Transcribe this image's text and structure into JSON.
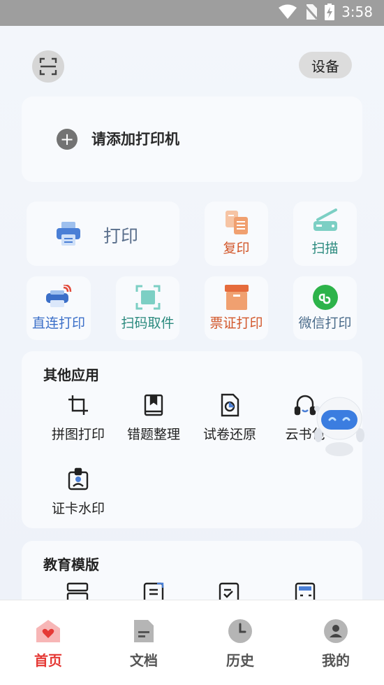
{
  "status_bar": {
    "time": "3:58"
  },
  "header": {
    "device_button": "设备"
  },
  "printer": {
    "add_label": "请添加打印机"
  },
  "main_actions": {
    "print": "打印",
    "copy": "复印",
    "scan": "扫描"
  },
  "quick_actions": [
    {
      "label": "直连打印",
      "color": "#3b6fc8"
    },
    {
      "label": "扫码取件",
      "color": "#2b8a7e"
    },
    {
      "label": "票证打印",
      "color": "#d2572a"
    },
    {
      "label": "微信打印",
      "color": "#4a6b8a"
    }
  ],
  "other_apps": {
    "title": "其他应用",
    "items": [
      {
        "label": "拼图打印"
      },
      {
        "label": "错题整理"
      },
      {
        "label": "试卷还原"
      },
      {
        "label": "云书包"
      },
      {
        "label": "证卡水印"
      }
    ]
  },
  "education": {
    "title": "教育模版"
  },
  "tabs": [
    {
      "label": "首页",
      "active": true
    },
    {
      "label": "文档",
      "active": false
    },
    {
      "label": "历史",
      "active": false
    },
    {
      "label": "我的",
      "active": false
    }
  ],
  "colors": {
    "accent_red": "#e53935",
    "print_blue": "#4a7fd6",
    "copy_orange": "#f0a070",
    "scan_teal": "#7ccfc4",
    "wechat_green": "#2db34a"
  }
}
